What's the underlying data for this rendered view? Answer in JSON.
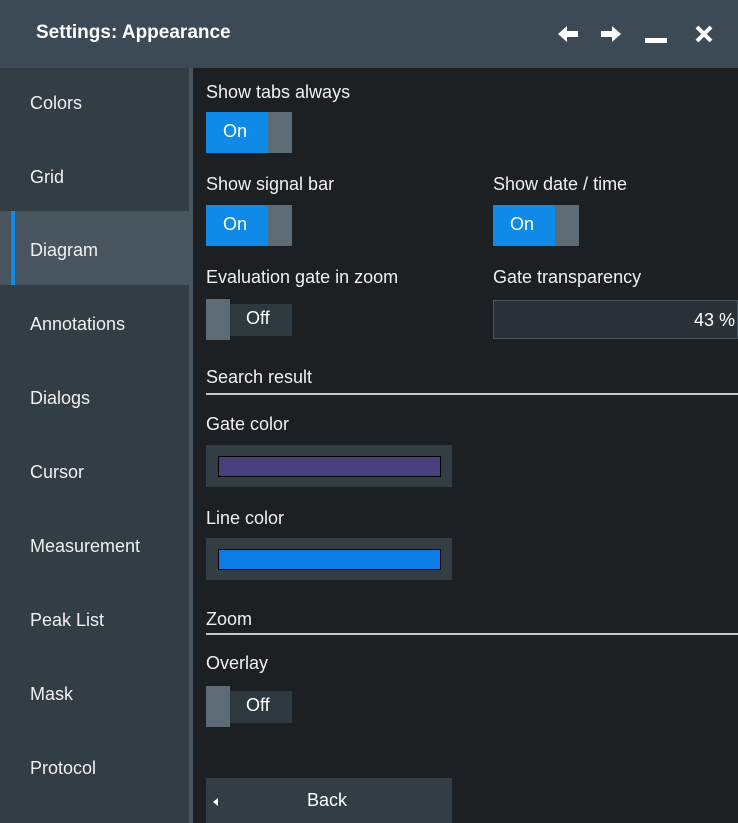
{
  "window": {
    "title": "Settings: Appearance",
    "buttons": [
      "back-arrow",
      "forward-arrow",
      "minimize",
      "close"
    ]
  },
  "sidebar": {
    "items": [
      {
        "label": "Colors",
        "active": false
      },
      {
        "label": "Grid",
        "active": false
      },
      {
        "label": "Diagram",
        "active": true
      },
      {
        "label": "Annotations",
        "active": false
      },
      {
        "label": "Dialogs",
        "active": false
      },
      {
        "label": "Cursor",
        "active": false
      },
      {
        "label": "Measurement",
        "active": false
      },
      {
        "label": "Peak List",
        "active": false
      },
      {
        "label": "Mask",
        "active": false
      },
      {
        "label": "Protocol",
        "active": false
      }
    ]
  },
  "settings": {
    "show_tabs_always": {
      "label": "Show tabs always",
      "value": "On"
    },
    "show_signal_bar": {
      "label": "Show signal bar",
      "value": "On"
    },
    "show_date_time": {
      "label": "Show date / time",
      "value": "On"
    },
    "evaluation_gate_in_zoom": {
      "label": "Evaluation gate in zoom",
      "value": "Off"
    },
    "gate_transparency": {
      "label": "Gate transparency",
      "value": "43 %"
    }
  },
  "search_result": {
    "heading": "Search result",
    "gate_color": {
      "label": "Gate color",
      "color": "#4a3f7d"
    },
    "line_color": {
      "label": "Line color",
      "color": "#0a7ee6"
    }
  },
  "zoom": {
    "heading": "Zoom",
    "overlay": {
      "label": "Overlay",
      "value": "Off"
    }
  },
  "footer": {
    "back_label": "Back"
  },
  "colors": {
    "accent": "#0f8ae6",
    "titlebar": "#3b4a55",
    "sidebar": "#323d44",
    "background": "#1c2023"
  }
}
